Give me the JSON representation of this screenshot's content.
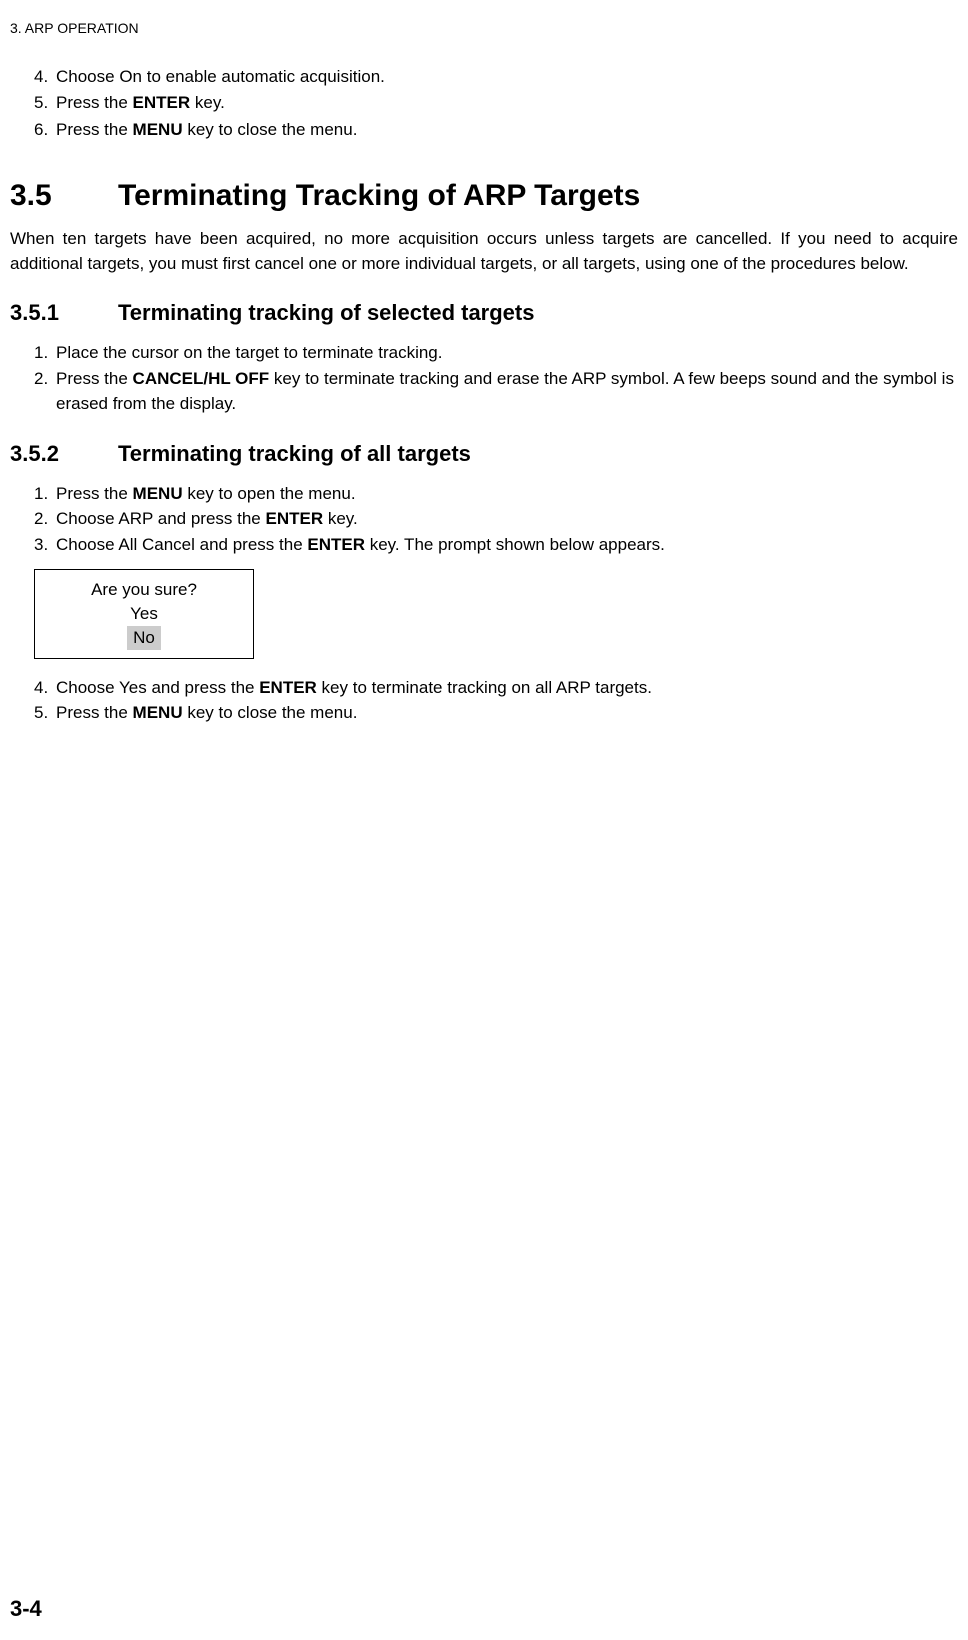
{
  "header": {
    "chapter": "3. ARP OPERATION"
  },
  "first_list": [
    {
      "n": "4.",
      "pre": "Choose On to enable automatic acquisition.",
      "bold": "",
      "post": ""
    },
    {
      "n": "5.",
      "pre": "Press the ",
      "bold": "ENTER",
      "post": " key."
    },
    {
      "n": "6.",
      "pre": "Press the ",
      "bold": "MENU",
      "post": " key to close the menu."
    }
  ],
  "section": {
    "num": "3.5",
    "title": "Terminating Tracking of ARP Targets",
    "intro": "When ten targets have been acquired, no more acquisition occurs unless targets are cancelled. If you need to acquire additional targets, you must first cancel one or more individual targets, or all targets, using one of the procedures below."
  },
  "sub1": {
    "num": "3.5.1",
    "title": "Terminating tracking of selected targets",
    "steps": [
      {
        "n": "1.",
        "pre": "Place the cursor on the target to terminate tracking.",
        "bold": "",
        "post": ""
      },
      {
        "n": "2.",
        "pre": "Press the ",
        "bold": "CANCEL/HL OFF",
        "post": " key to terminate tracking and erase the ARP symbol. A few beeps sound and the symbol is erased from the display."
      }
    ]
  },
  "sub2": {
    "num": "3.5.2",
    "title": "Terminating tracking of all targets",
    "steps_a": [
      {
        "n": "1.",
        "pre": "Press the ",
        "bold": "MENU",
        "post": " key to open the menu."
      },
      {
        "n": "2.",
        "pre": "Choose ARP and press the ",
        "bold": "ENTER",
        "post": " key."
      },
      {
        "n": "3.",
        "pre": "Choose All Cancel and press the ",
        "bold": "ENTER",
        "post": " key. The prompt shown below appears."
      }
    ],
    "prompt": {
      "q": "Are you sure?",
      "yes": "Yes",
      "no": "No"
    },
    "steps_b": [
      {
        "n": "4.",
        "pre": "Choose Yes and press the ",
        "bold": "ENTER",
        "post": " key to terminate tracking on all ARP targets."
      },
      {
        "n": "5.",
        "pre": "Press the ",
        "bold": "MENU",
        "post": " key to close the menu."
      }
    ]
  },
  "footer": {
    "page": "3-4"
  }
}
